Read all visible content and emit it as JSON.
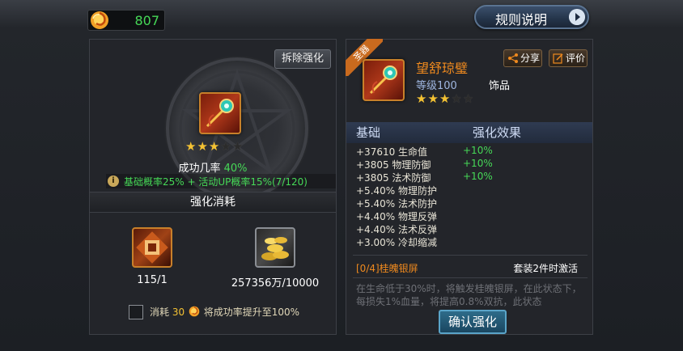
{
  "currency": {
    "value": "807",
    "icon": "gold-swirl-icon"
  },
  "rules_button": {
    "label": "规则说明"
  },
  "left": {
    "dismantle_label": "拆除强化",
    "item_stars": {
      "filled": 3,
      "total": 5
    },
    "success_rate_label": "成功几率",
    "success_rate_value": "40%",
    "bonus_text": "基础概率25% + 活动UP概率15%(7/120)",
    "section_title": "强化消耗",
    "materials": [
      {
        "icon": "enhance-stone-icon",
        "count": "115/1"
      },
      {
        "icon": "gold-coins-icon",
        "count": "257356万/10000"
      }
    ],
    "consume": {
      "prefix": "消耗",
      "amount": "30",
      "suffix": "将成功率提升至100%"
    }
  },
  "right": {
    "ribbon": "圣器",
    "item_name": "望舒琼璧",
    "item_level": "等级100",
    "item_type": "饰品",
    "share_label": "分享",
    "review_label": "评价",
    "stars": {
      "filled": 3,
      "total": 5
    },
    "headers": {
      "base": "基础",
      "effect": "强化效果"
    },
    "stats": [
      {
        "text": "+37610 生命值",
        "bonus": "+10%"
      },
      {
        "text": "+3805 物理防御",
        "bonus": "+10%"
      },
      {
        "text": "+3805 法术防御",
        "bonus": "+10%"
      },
      {
        "text": "+5.40% 物理防护",
        "bonus": ""
      },
      {
        "text": "+5.40% 法术防护",
        "bonus": ""
      },
      {
        "text": "+4.40% 物理反弹",
        "bonus": ""
      },
      {
        "text": "+4.40% 法术反弹",
        "bonus": ""
      },
      {
        "text": "+3.00% 冷却缩减",
        "bonus": ""
      }
    ],
    "set_name": "[0/4]桂魄银屏",
    "set_note": "套装2件时激活",
    "set_desc": "在生命低于30%时，将触发桂魄银屏，在此状态下，每损失1%血量，将提高0.8%双抗，此状态",
    "confirm_label": "确认强化"
  }
}
